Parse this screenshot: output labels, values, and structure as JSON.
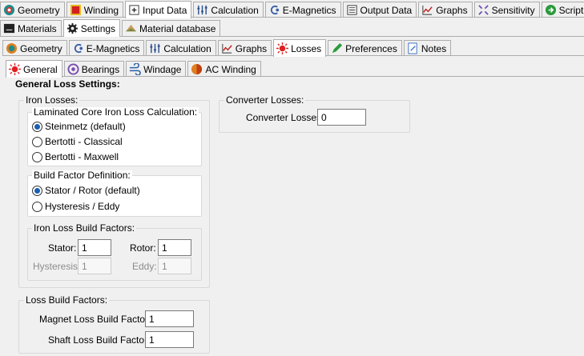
{
  "top_tabs": [
    {
      "label": "Geometry",
      "icon": "geometry-icon"
    },
    {
      "label": "Winding",
      "icon": "winding-icon"
    },
    {
      "label": "Input Data",
      "icon": "input-data-icon",
      "selected": true
    },
    {
      "label": "Calculation",
      "icon": "calculation-icon"
    },
    {
      "label": "E-Magnetics",
      "icon": "e-magnetics-icon"
    },
    {
      "label": "Output Data",
      "icon": "output-data-icon"
    },
    {
      "label": "Graphs",
      "icon": "graphs-icon"
    },
    {
      "label": "Sensitivity",
      "icon": "sensitivity-icon"
    },
    {
      "label": "Scripting",
      "icon": "scripting-icon"
    }
  ],
  "second_tabs": [
    {
      "label": "Materials",
      "icon": "materials-icon"
    },
    {
      "label": "Settings",
      "icon": "settings-gear-icon",
      "selected": true
    },
    {
      "label": "Material database",
      "icon": "material-database-icon"
    }
  ],
  "third_tabs": [
    {
      "label": "Geometry",
      "icon": "geometry-icon"
    },
    {
      "label": "E-Magnetics",
      "icon": "e-magnetics-icon"
    },
    {
      "label": "Calculation",
      "icon": "calculation-icon"
    },
    {
      "label": "Graphs",
      "icon": "graphs-icon"
    },
    {
      "label": "Losses",
      "icon": "losses-icon",
      "selected": true
    },
    {
      "label": "Preferences",
      "icon": "preferences-pencil-icon"
    },
    {
      "label": "Notes",
      "icon": "notes-icon"
    }
  ],
  "fourth_tabs": [
    {
      "label": "General",
      "icon": "losses-icon",
      "selected": true
    },
    {
      "label": "Bearings",
      "icon": "bearings-icon"
    },
    {
      "label": "Windage",
      "icon": "windage-icon"
    },
    {
      "label": "AC Winding",
      "icon": "ac-winding-icon"
    }
  ],
  "page_title": "General Loss Settings:",
  "iron_losses": {
    "legend": "Iron Losses:",
    "laminated": {
      "legend": "Laminated Core Iron Loss Calculation:",
      "options": [
        "Steinmetz (default)",
        "Bertotti - Classical",
        "Bertotti - Maxwell"
      ],
      "selected": "Steinmetz (default)"
    },
    "build_factor_def": {
      "legend": "Build Factor Definition:",
      "options": [
        "Stator / Rotor (default)",
        "Hysteresis / Eddy"
      ],
      "selected": "Stator / Rotor (default)"
    },
    "iron_build": {
      "legend": "Iron Loss Build Factors:",
      "stator_label": "Stator:",
      "stator_value": "1",
      "rotor_label": "Rotor:",
      "rotor_value": "1",
      "hysteresis_label": "Hysteresis:",
      "hysteresis_value": "1",
      "eddy_label": "Eddy:",
      "eddy_value": "1"
    }
  },
  "loss_build": {
    "legend": "Loss Build Factors:",
    "magnet_label": "Magnet Loss Build Factor:",
    "magnet_value": "1",
    "shaft_label": "Shaft Loss Build Factor:",
    "shaft_value": "1"
  },
  "converter": {
    "legend": "Converter Losses:",
    "label": "Converter Losses:",
    "value": "0"
  },
  "colors": {
    "selected_radio": "#1a5fb4",
    "tab_border": "#adadad",
    "background": "#f0f0f0"
  }
}
